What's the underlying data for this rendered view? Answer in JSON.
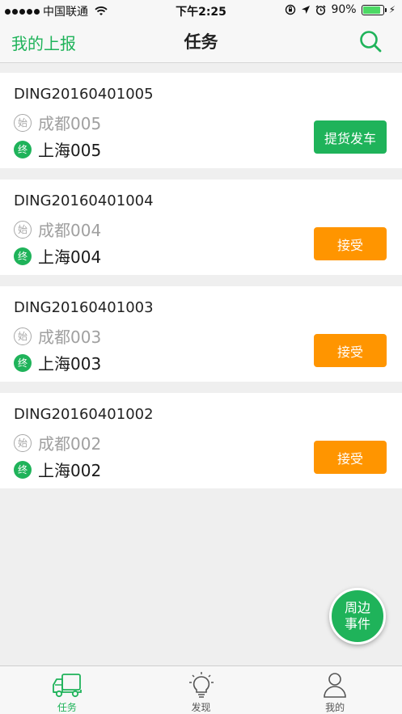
{
  "status_bar": {
    "carrier": "中国联通",
    "time": "下午2:25",
    "battery": "90%",
    "battery_level": 0.9
  },
  "nav": {
    "left_label": "我的上报",
    "title": "任务",
    "search_icon": "search-icon"
  },
  "tasks": [
    {
      "id": "DING20160401005",
      "start_badge": "始",
      "start": "成都005",
      "end_badge": "终",
      "end": "上海005",
      "action": "提货发车",
      "action_color": "#1fb35a"
    },
    {
      "id": "DING20160401004",
      "start_badge": "始",
      "start": "成都004",
      "end_badge": "终",
      "end": "上海004",
      "action": "接受",
      "action_color": "#ff9500"
    },
    {
      "id": "DING20160401003",
      "start_badge": "始",
      "start": "成都003",
      "end_badge": "终",
      "end": "上海003",
      "action": "接受",
      "action_color": "#ff9500"
    },
    {
      "id": "DING20160401002",
      "start_badge": "始",
      "start": "成都002",
      "end_badge": "终",
      "end": "上海002",
      "action": "接受",
      "action_color": "#ff9500"
    }
  ],
  "fab": {
    "line1": "周边",
    "line2": "事件"
  },
  "tabs": [
    {
      "label": "任务",
      "icon": "truck-icon",
      "active": true
    },
    {
      "label": "发现",
      "icon": "lightbulb-icon",
      "active": false
    },
    {
      "label": "我的",
      "icon": "person-icon",
      "active": false
    }
  ],
  "colors": {
    "accent": "#1fb35a",
    "orange": "#ff9500"
  }
}
